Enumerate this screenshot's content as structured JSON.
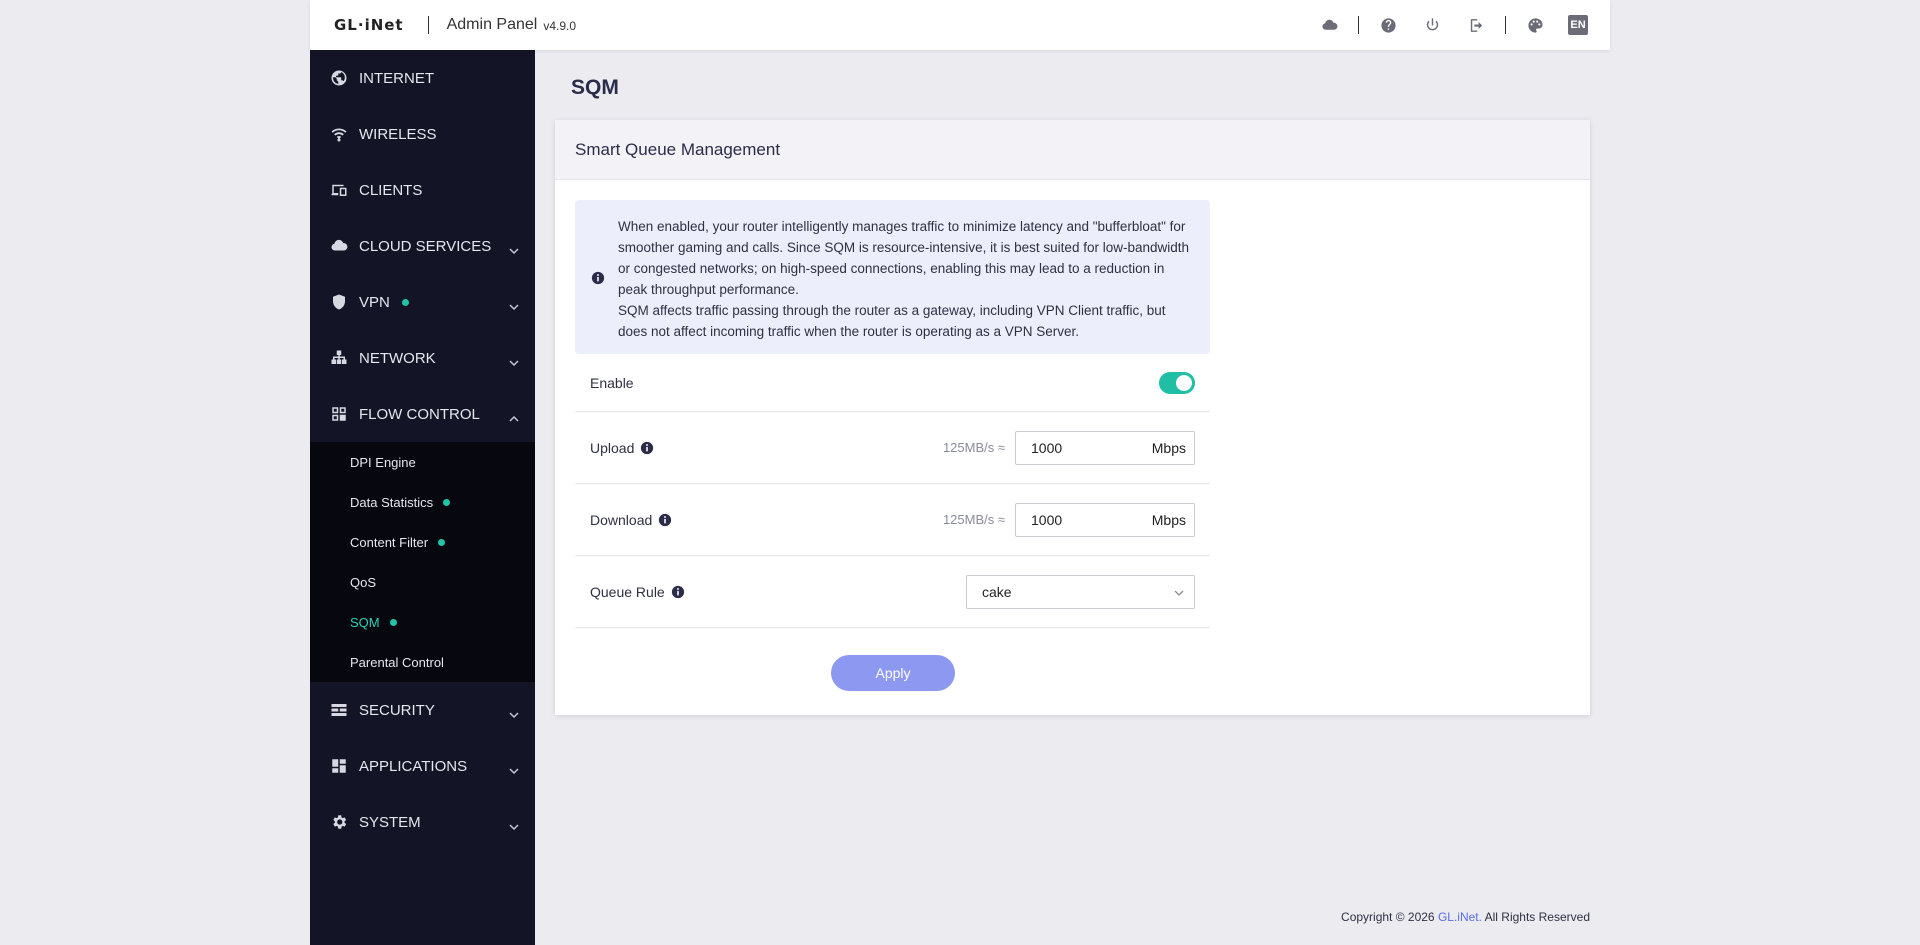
{
  "header": {
    "logo": "GL·iNet",
    "title": "Admin Panel",
    "version": "v4.9.0",
    "icons": [
      "cloud-icon",
      "help-icon",
      "power-icon",
      "logout-icon",
      "palette-icon"
    ],
    "lang": "EN"
  },
  "sidebar": {
    "items": [
      {
        "label": "INTERNET",
        "icon": "globe-icon",
        "chevron": false,
        "dot": false
      },
      {
        "label": "WIRELESS",
        "icon": "wifi-icon",
        "chevron": false,
        "dot": false
      },
      {
        "label": "CLIENTS",
        "icon": "devices-icon",
        "chevron": false,
        "dot": false
      },
      {
        "label": "CLOUD SERVICES",
        "icon": "cloud-icon",
        "chevron": "down",
        "dot": false
      },
      {
        "label": "VPN",
        "icon": "shield-icon",
        "chevron": "down",
        "dot": true
      },
      {
        "label": "NETWORK",
        "icon": "network-icon",
        "chevron": "down",
        "dot": false
      },
      {
        "label": "FLOW CONTROL",
        "icon": "flow-icon",
        "chevron": "up",
        "dot": false
      },
      {
        "label": "SECURITY",
        "icon": "firewall-icon",
        "chevron": "down",
        "dot": false
      },
      {
        "label": "APPLICATIONS",
        "icon": "apps-icon",
        "chevron": "down",
        "dot": false
      },
      {
        "label": "SYSTEM",
        "icon": "gear-icon",
        "chevron": "down",
        "dot": false
      }
    ],
    "flow_control_sub": [
      {
        "label": "DPI Engine",
        "dot": false,
        "active": false
      },
      {
        "label": "Data Statistics",
        "dot": true,
        "active": false
      },
      {
        "label": "Content Filter",
        "dot": true,
        "active": false
      },
      {
        "label": "QoS",
        "dot": false,
        "active": false
      },
      {
        "label": "SQM",
        "dot": true,
        "active": true
      },
      {
        "label": "Parental Control",
        "dot": false,
        "active": false
      }
    ]
  },
  "page": {
    "title": "SQM",
    "card_title": "Smart Queue Management",
    "notice_line1": "When enabled, your router intelligently manages traffic to minimize latency and \"bufferbloat\" for smoother gaming and calls. Since SQM is resource-intensive, it is best suited for low-bandwidth or congested networks; on high-speed connections, enabling this may lead to a reduction in peak throughput performance.",
    "notice_line2": "SQM affects traffic passing through the router as a gateway, including VPN Client traffic, but does not affect incoming traffic when the router is operating as a VPN Server.",
    "enable_label": "Enable",
    "enabled": true,
    "upload_label": "Upload",
    "upload_approx": "125MB/s ≈",
    "upload_value": "1000",
    "download_label": "Download",
    "download_approx": "125MB/s ≈",
    "download_value": "1000",
    "unit": "Mbps",
    "queue_label": "Queue Rule",
    "queue_value": "cake",
    "apply_label": "Apply"
  },
  "footer": {
    "prefix": "Copyright © 2026 ",
    "link": "GL.iNet.",
    "suffix": " All Rights Reserved"
  },
  "colors": {
    "accent": "#1fbfa6",
    "sidebar_bg": "#131425",
    "apply_button": "#8d98f0",
    "link": "#5b6ce8"
  }
}
